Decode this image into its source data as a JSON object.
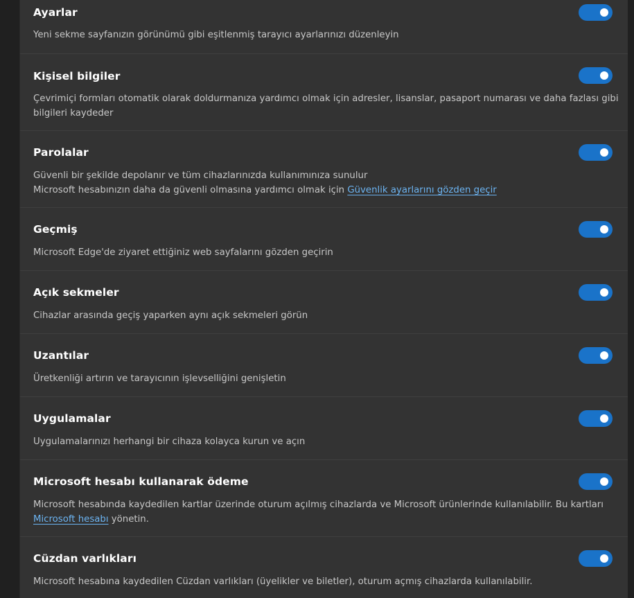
{
  "settings": [
    {
      "title": "Ayarlar",
      "desc_lines": [
        "Yeni sekme sayfanızın görünümü gibi eşitlenmiş tarayıcı ayarlarınızı düzenleyin"
      ],
      "enabled": true
    },
    {
      "title": "Kişisel bilgiler",
      "desc_lines": [
        "Çevrimiçi formları otomatik olarak doldurmanıza yardımcı olmak için adresler, lisanslar, pasaport numarası ve daha fazlası gibi",
        "bilgileri kaydeder"
      ],
      "enabled": true
    },
    {
      "title": "Parolalar",
      "desc_lines": [
        "Güvenli bir şekilde depolanır ve tüm cihazlarınızda kullanımınıza sunulur"
      ],
      "desc_prefix": "Microsoft hesabınızın daha da güvenli olmasına yardımcı olmak için ",
      "desc_link": "Güvenlik ayarlarını gözden geçir",
      "enabled": true
    },
    {
      "title": "Geçmiş",
      "desc_lines": [
        "Microsoft Edge'de ziyaret ettiğiniz web sayfalarını gözden geçirin"
      ],
      "enabled": true
    },
    {
      "title": "Açık sekmeler",
      "desc_lines": [
        "Cihazlar arasında geçiş yaparken aynı açık sekmeleri görün"
      ],
      "enabled": true
    },
    {
      "title": "Uzantılar",
      "desc_lines": [
        "Üretkenliği artırın ve tarayıcının işlevselliğini genişletin"
      ],
      "enabled": true
    },
    {
      "title": "Uygulamalar",
      "desc_lines": [
        "Uygulamalarınızı herhangi bir cihaza kolayca kurun ve açın"
      ],
      "enabled": true
    },
    {
      "title": "Microsoft hesabı kullanarak ödeme",
      "desc_lines": [
        "Microsoft hesabında kaydedilen kartlar üzerinde oturum açılmış cihazlarda ve Microsoft ürünlerinde kullanılabilir. Bu kartları"
      ],
      "desc_link": "Microsoft hesabı",
      "desc_suffix": " yönetin.",
      "enabled": true
    },
    {
      "title": "Cüzdan varlıkları",
      "desc_lines": [
        "Microsoft hesabına kaydedilen Cüzdan varlıkları (üyelikler ve biletler), oturum açmış cihazlarda kullanılabilir."
      ],
      "enabled": true
    }
  ],
  "colors": {
    "toggle_on": "#1a73c9",
    "link": "#6cb4f2",
    "panel_bg": "#333333",
    "page_bg": "#202020"
  }
}
